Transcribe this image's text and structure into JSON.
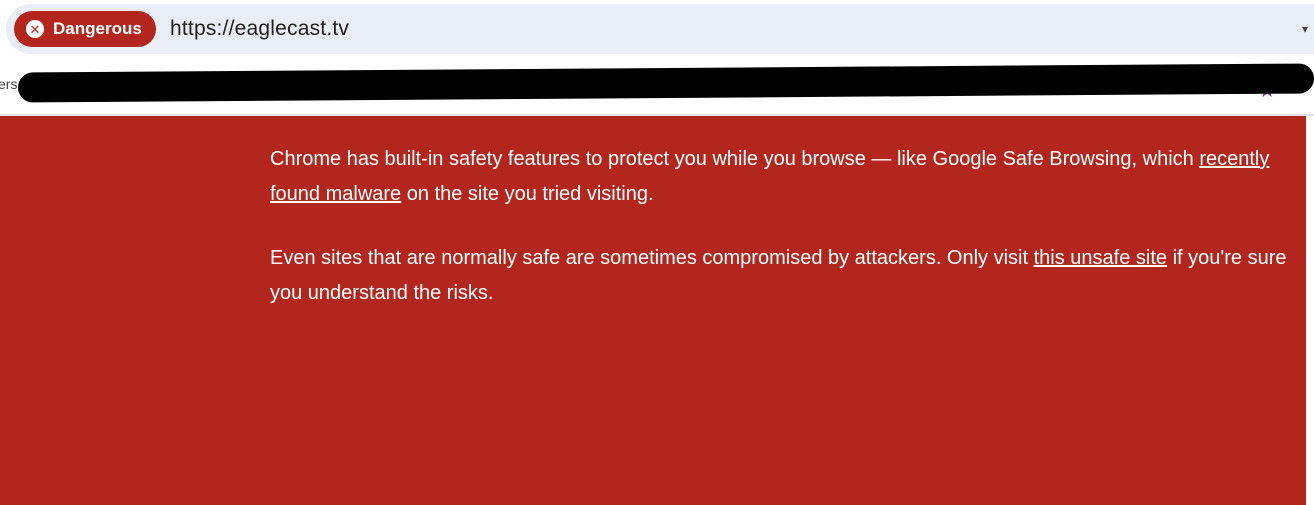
{
  "omnibox": {
    "security_chip_label": "Dangerous",
    "security_chip_icon": "error-x-icon",
    "url": "https://eaglecast.tv"
  },
  "bookmarks_bar": {
    "partial_left_text": "ers"
  },
  "warning": {
    "paragraph1": {
      "before": "Chrome has built-in safety features to protect you while you browse — like Google Safe Browsing, which ",
      "link": "recently found malware",
      "after": " on the site you tried visiting."
    },
    "paragraph2": {
      "before": "Even sites that are normally safe are sometimes compromised by attackers. Only visit ",
      "link": "this unsafe site",
      "after": " if you're sure you understand the risks."
    }
  },
  "colors": {
    "danger_red": "#b3261e",
    "omnibox_bg": "#e9eef6"
  }
}
